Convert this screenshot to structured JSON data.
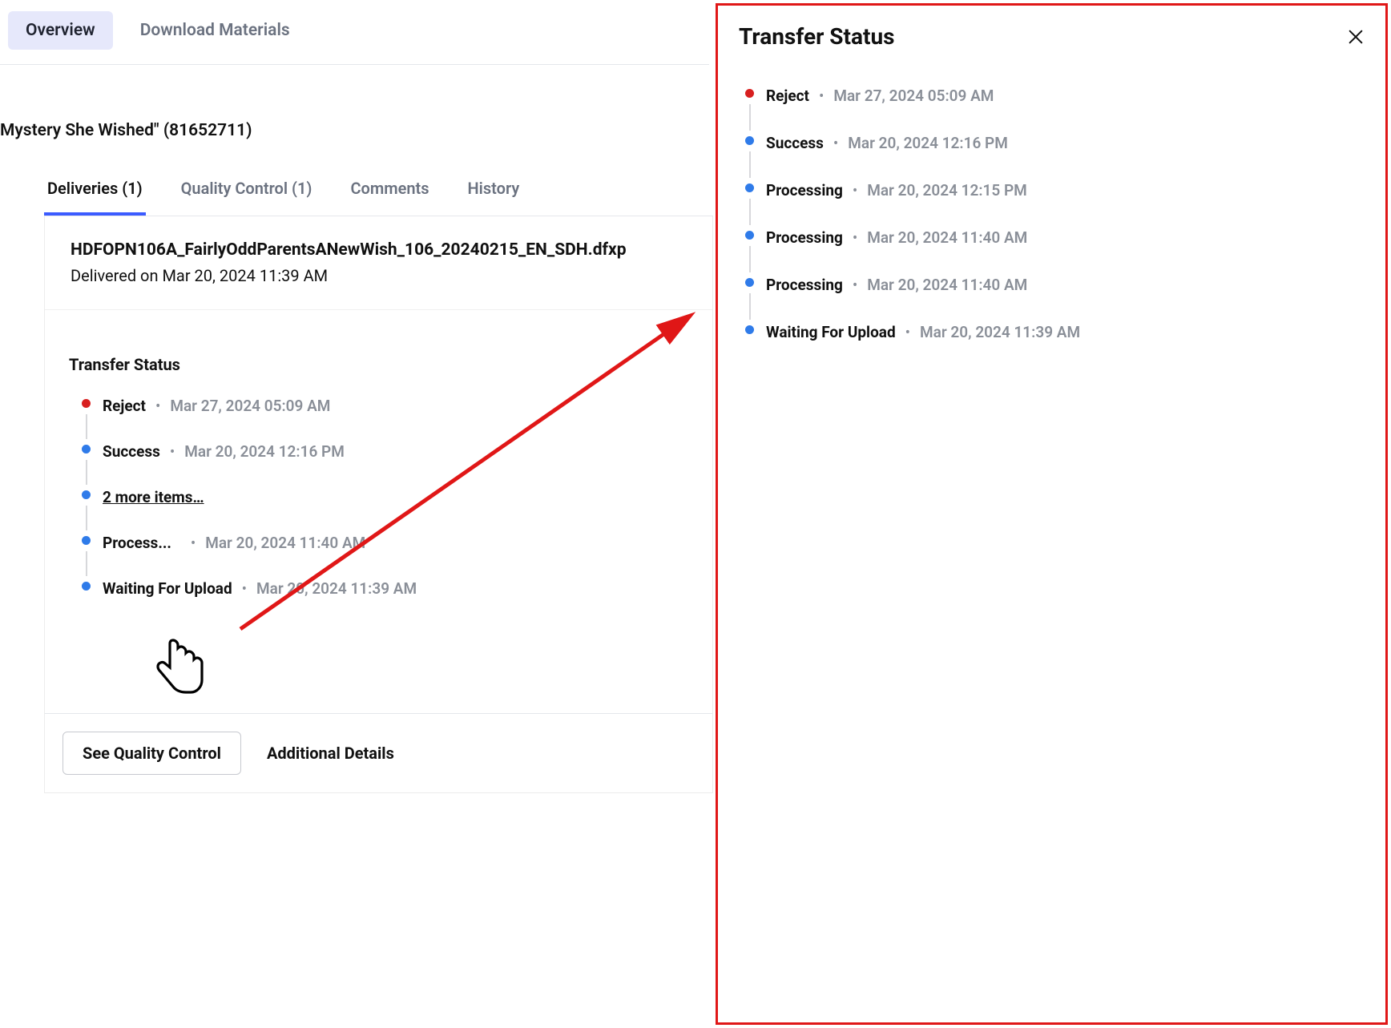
{
  "topnav": {
    "overview": "Overview",
    "download_materials": "Download Materials"
  },
  "breadcrumb": "Mystery She Wished\" (81652711)",
  "card_tabs": {
    "deliveries": "Deliveries (1)",
    "quality_control": "Quality Control (1)",
    "comments": "Comments",
    "history": "History"
  },
  "delivery": {
    "file_name": "HDFOPN106A_FairlyOddParentsANewWish_106_20240215_EN_SDH.dfxp",
    "delivered_on": "Delivered on Mar 20, 2024 11:39 AM"
  },
  "transfer_status_title": "Transfer Status",
  "compact_timeline": [
    {
      "label": "Reject",
      "date": "Mar 27, 2024 05:09 AM",
      "color": "red"
    },
    {
      "label": "Success",
      "date": "Mar 20, 2024 12:16 PM",
      "color": "blue"
    },
    {
      "more_link": "2 more items…",
      "color": "blue"
    },
    {
      "label": "Process...",
      "date": "Mar 20, 2024 11:40 AM",
      "color": "blue"
    },
    {
      "label": "Waiting For Upload",
      "date": "Mar 20, 2024 11:39 AM",
      "color": "blue",
      "last": true
    }
  ],
  "actions": {
    "see_qc": "See Quality Control",
    "additional": "Additional Details"
  },
  "panel": {
    "title": "Transfer Status",
    "timeline": [
      {
        "label": "Reject",
        "date": "Mar 27, 2024 05:09 AM",
        "color": "red"
      },
      {
        "label": "Success",
        "date": "Mar 20, 2024 12:16 PM",
        "color": "blue"
      },
      {
        "label": "Processing",
        "date": "Mar 20, 2024 12:15 PM",
        "color": "blue"
      },
      {
        "label": "Processing",
        "date": "Mar 20, 2024 11:40 AM",
        "color": "blue"
      },
      {
        "label": "Processing",
        "date": "Mar 20, 2024 11:40 AM",
        "color": "blue"
      },
      {
        "label": "Waiting For Upload",
        "date": "Mar 20, 2024 11:39 AM",
        "color": "blue",
        "last": true
      }
    ]
  }
}
